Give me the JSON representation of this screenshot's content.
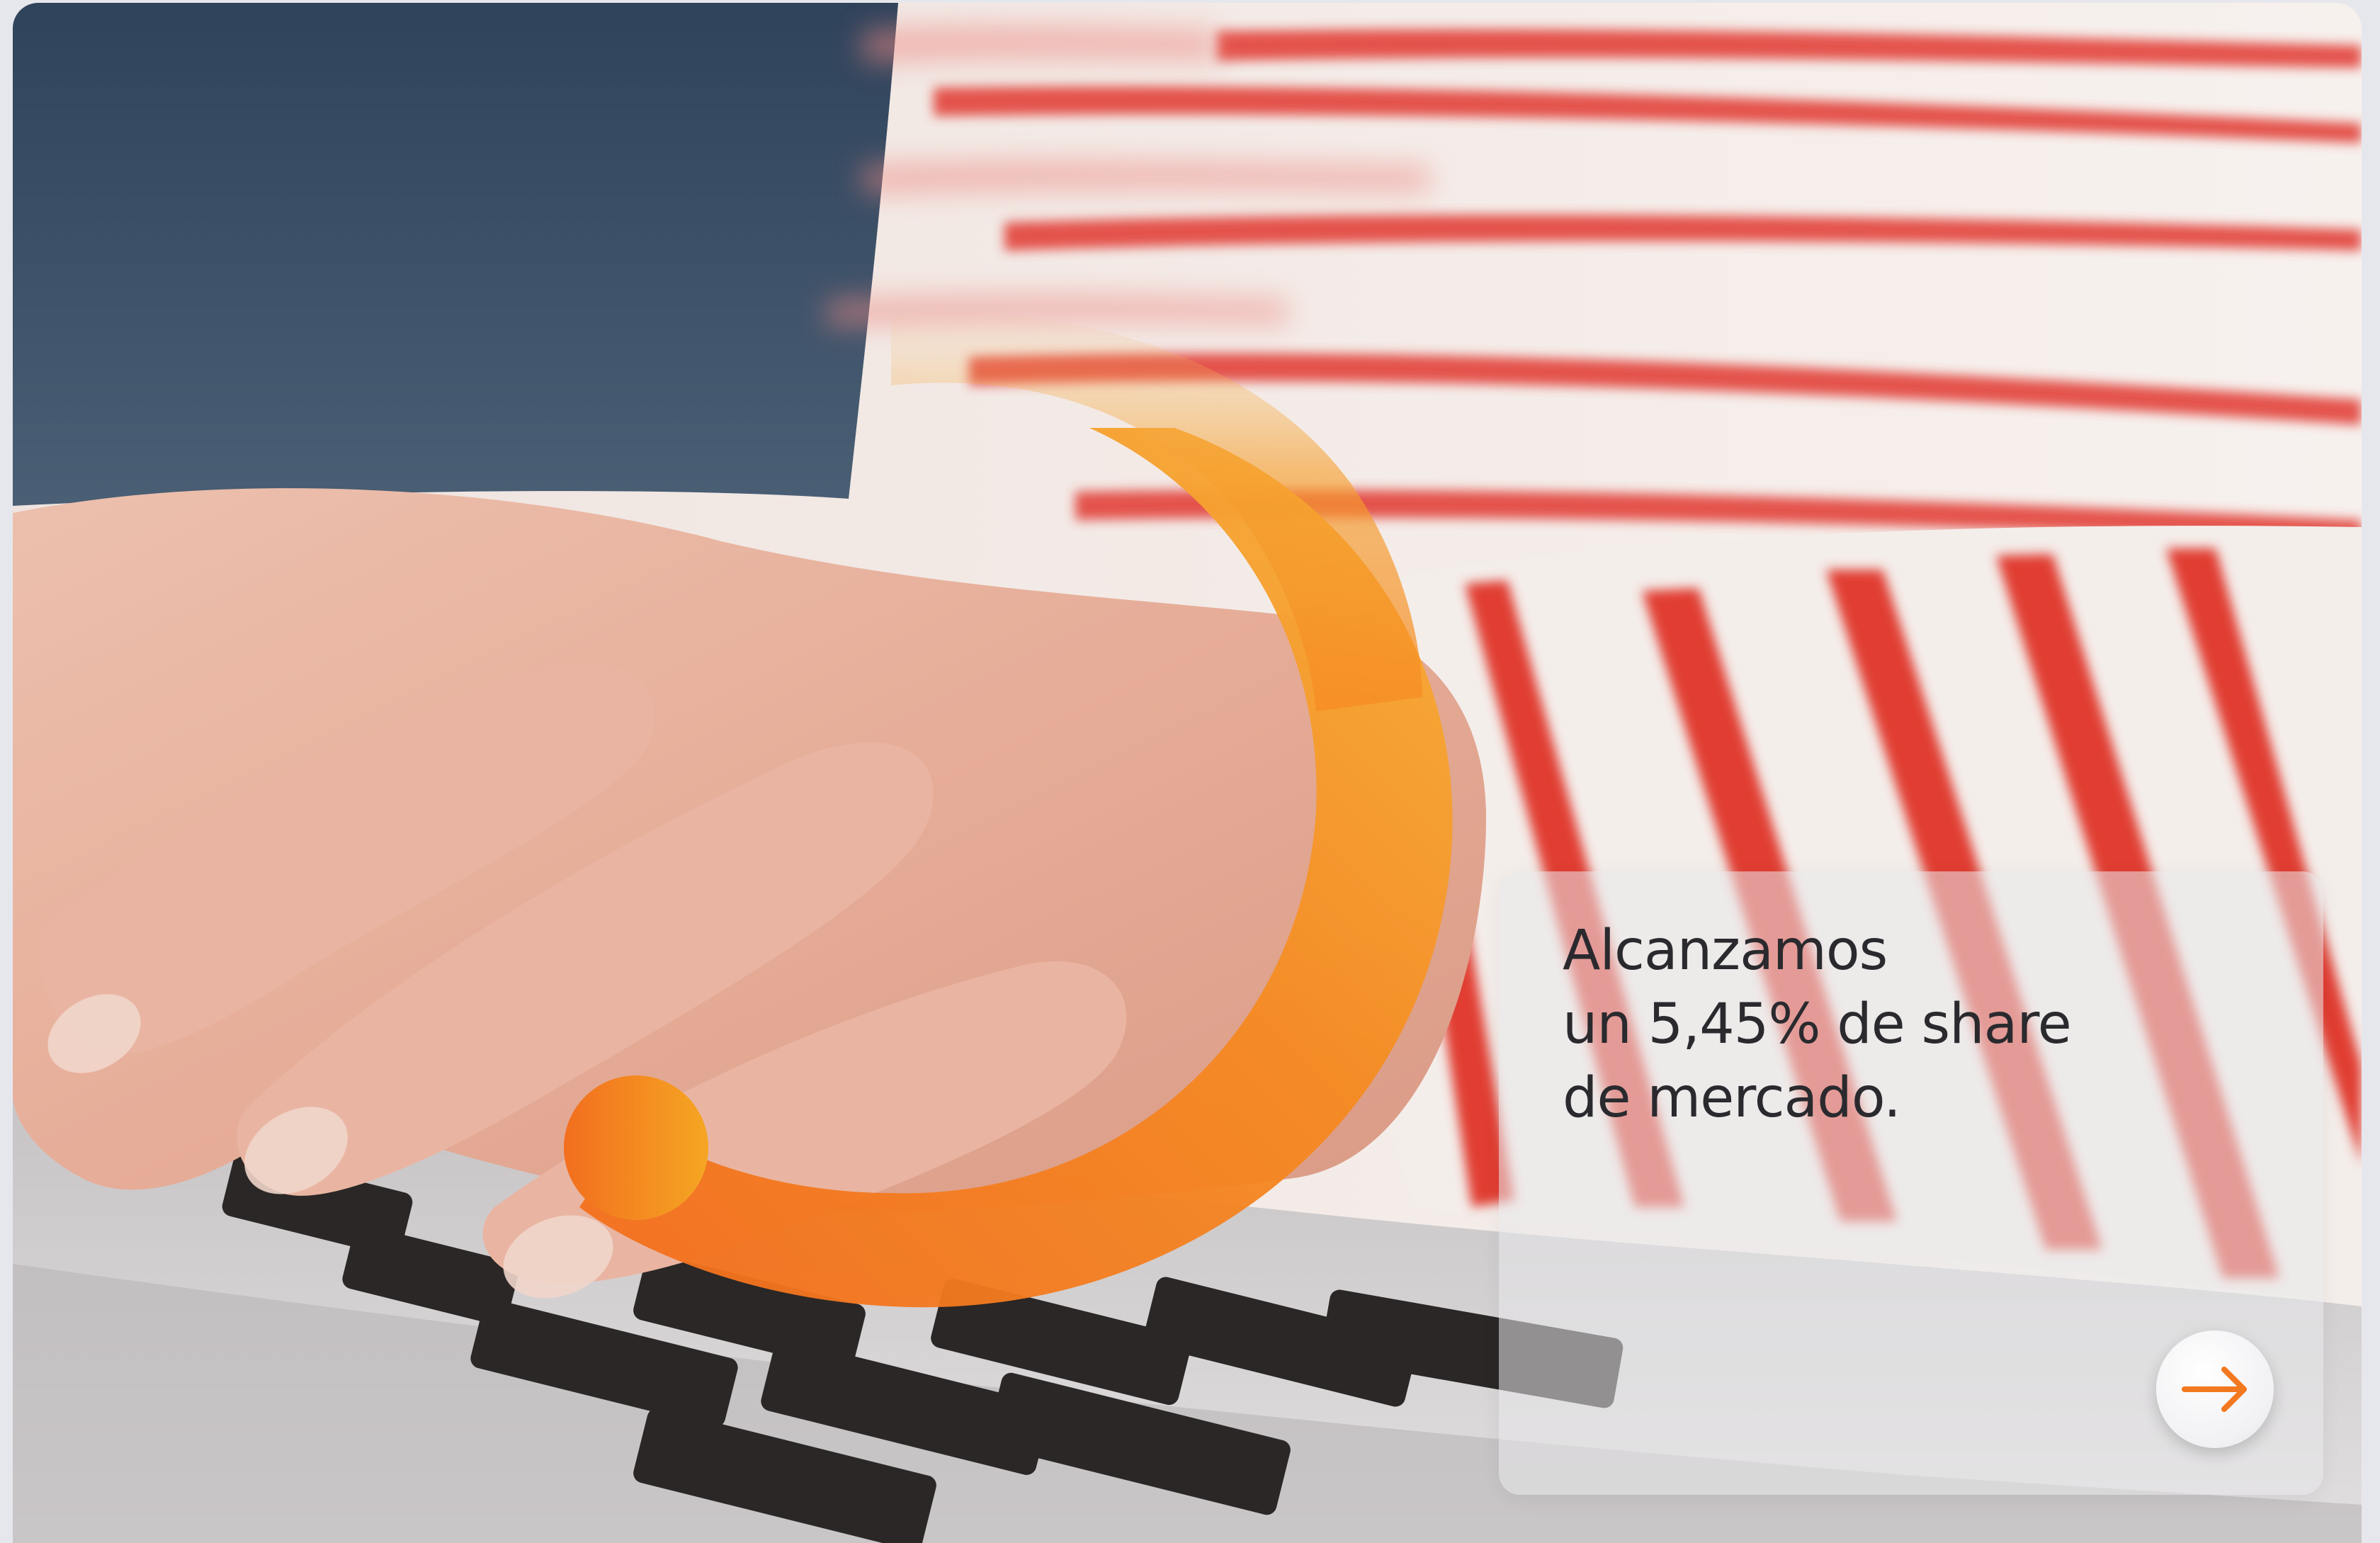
{
  "headline": {
    "line1": "Alcanzamos",
    "line2": "un 5,45% de share",
    "line3": "de mercado."
  },
  "cta": {
    "icon": "arrow-right-icon"
  },
  "colors": {
    "accent_orange": "#f2791f",
    "accent_orange_light": "#f5a623",
    "text_dark": "#2a2a2e",
    "stripe_red": "#e13c33",
    "background_navy": "#3c5068"
  },
  "hero_image": {
    "description_icon": "photo-typing-on-laptop"
  }
}
